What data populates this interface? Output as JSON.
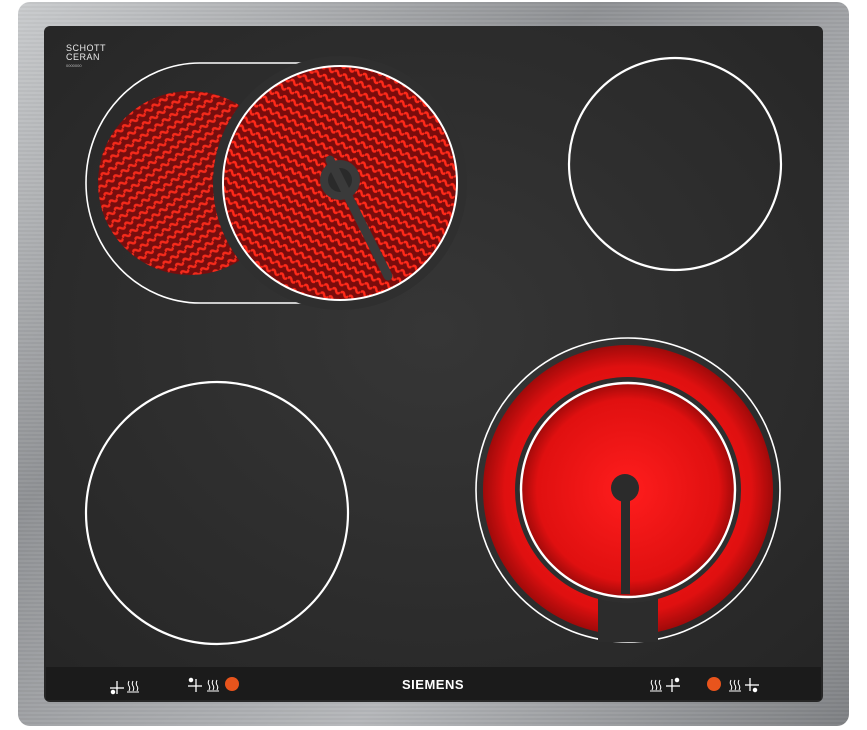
{
  "scene": {
    "description_free": true
  },
  "logo": {
    "line1": "SCHOTT",
    "line2": "CERAN",
    "fineprint": "0000000"
  },
  "brand": {
    "name": "SIEMENS"
  },
  "colors": {
    "frame": "#9a9c9e",
    "glass": "#2c2c2c",
    "strip": "#1c1c1c",
    "hot": "#e01414",
    "indicator": "#e8541c",
    "line": "#ffffff"
  },
  "controls": {
    "left": [
      {
        "icon": "zone-front-left-icon",
        "glyph": "⊹",
        "heat": "≋"
      },
      {
        "icon": "zone-rear-left-icon",
        "glyph": "⊹",
        "heat": "≋"
      }
    ],
    "right": [
      {
        "icon": "zone-rear-right-icon",
        "glyph": "⊹",
        "heat": "≋"
      },
      {
        "icon": "zone-front-right-icon",
        "glyph": "⊹",
        "heat": "≋"
      }
    ]
  }
}
